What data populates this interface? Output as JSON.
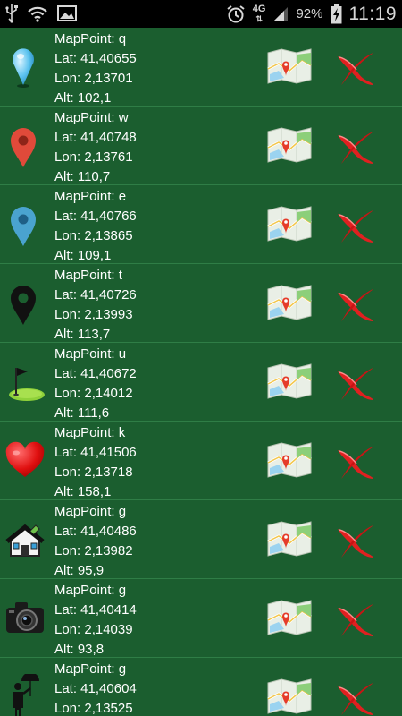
{
  "status_bar": {
    "network": "4G",
    "battery": "92%",
    "time": "11:19",
    "icons": [
      "usb-icon",
      "wifi-icon",
      "image-icon",
      "alarm-icon",
      "signal-icon",
      "battery-charging-icon"
    ]
  },
  "points": [
    {
      "name": "MapPoint: q",
      "lat": "Lat: 41,40655",
      "lon": "Lon: 2,13701",
      "alt": "Alt: 102,1",
      "icon": "light-blue-pin-icon"
    },
    {
      "name": "MapPoint: w",
      "lat": "Lat: 41,40748",
      "lon": "Lon: 2,13761",
      "alt": "Alt: 110,7",
      "icon": "red-marker-icon"
    },
    {
      "name": "MapPoint: e",
      "lat": "Lat: 41,40766",
      "lon": "Lon: 2,13865",
      "alt": "Alt: 109,1",
      "icon": "blue-marker-icon"
    },
    {
      "name": "MapPoint: t",
      "lat": "Lat: 41,40726",
      "lon": "Lon: 2,13993",
      "alt": "Alt: 113,7",
      "icon": "black-marker-icon"
    },
    {
      "name": "MapPoint: u",
      "lat": "Lat: 41,40672",
      "lon": "Lon: 2,14012",
      "alt": "Alt: 111,6",
      "icon": "golf-flag-icon"
    },
    {
      "name": "MapPoint: k",
      "lat": "Lat: 41,41506",
      "lon": "Lon: 2,13718",
      "alt": "Alt: 158,1",
      "icon": "heart-icon"
    },
    {
      "name": "MapPoint: g",
      "lat": "Lat: 41,40486",
      "lon": "Lon: 2,13982",
      "alt": "Alt: 95,9",
      "icon": "house-icon"
    },
    {
      "name": "MapPoint: g",
      "lat": "Lat: 41,40414",
      "lon": "Lon: 2,14039",
      "alt": "Alt: 93,8",
      "icon": "camera-icon"
    },
    {
      "name": "MapPoint: g",
      "lat": "Lat: 41,40604",
      "lon": "Lon: 2,13525",
      "alt": "",
      "icon": "person-umbrella-icon"
    }
  ],
  "action_icons": {
    "map": "map-icon",
    "delete": "delete-x-icon"
  },
  "colors": {
    "background": "#1b5e2f",
    "divider": "#2f7d46",
    "text": "#ffffff"
  }
}
